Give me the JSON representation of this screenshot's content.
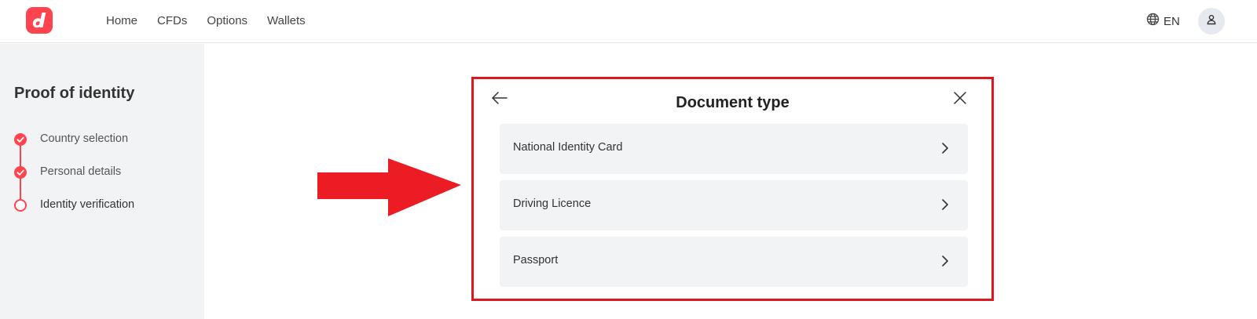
{
  "header": {
    "logo_icon": "deriv-logo-icon",
    "nav": [
      "Home",
      "CFDs",
      "Options",
      "Wallets"
    ],
    "language": "EN",
    "language_icon": "globe-icon",
    "account_icon": "user-icon"
  },
  "sidebar": {
    "title": "Proof of identity",
    "steps": [
      {
        "label": "Country selection",
        "status": "done"
      },
      {
        "label": "Personal details",
        "status": "done"
      },
      {
        "label": "Identity verification",
        "status": "current"
      }
    ]
  },
  "modal": {
    "title": "Document type",
    "back_icon": "arrow-left-icon",
    "close_icon": "close-icon",
    "options": [
      {
        "label": "National Identity Card"
      },
      {
        "label": "Driving Licence"
      },
      {
        "label": "Passport"
      }
    ]
  },
  "colors": {
    "brand": "#ff444f",
    "highlight_frame": "#e0161f",
    "arrow": "#ec1c24",
    "sidebar_bg": "#f2f3f4",
    "option_bg": "#f2f3f4"
  }
}
